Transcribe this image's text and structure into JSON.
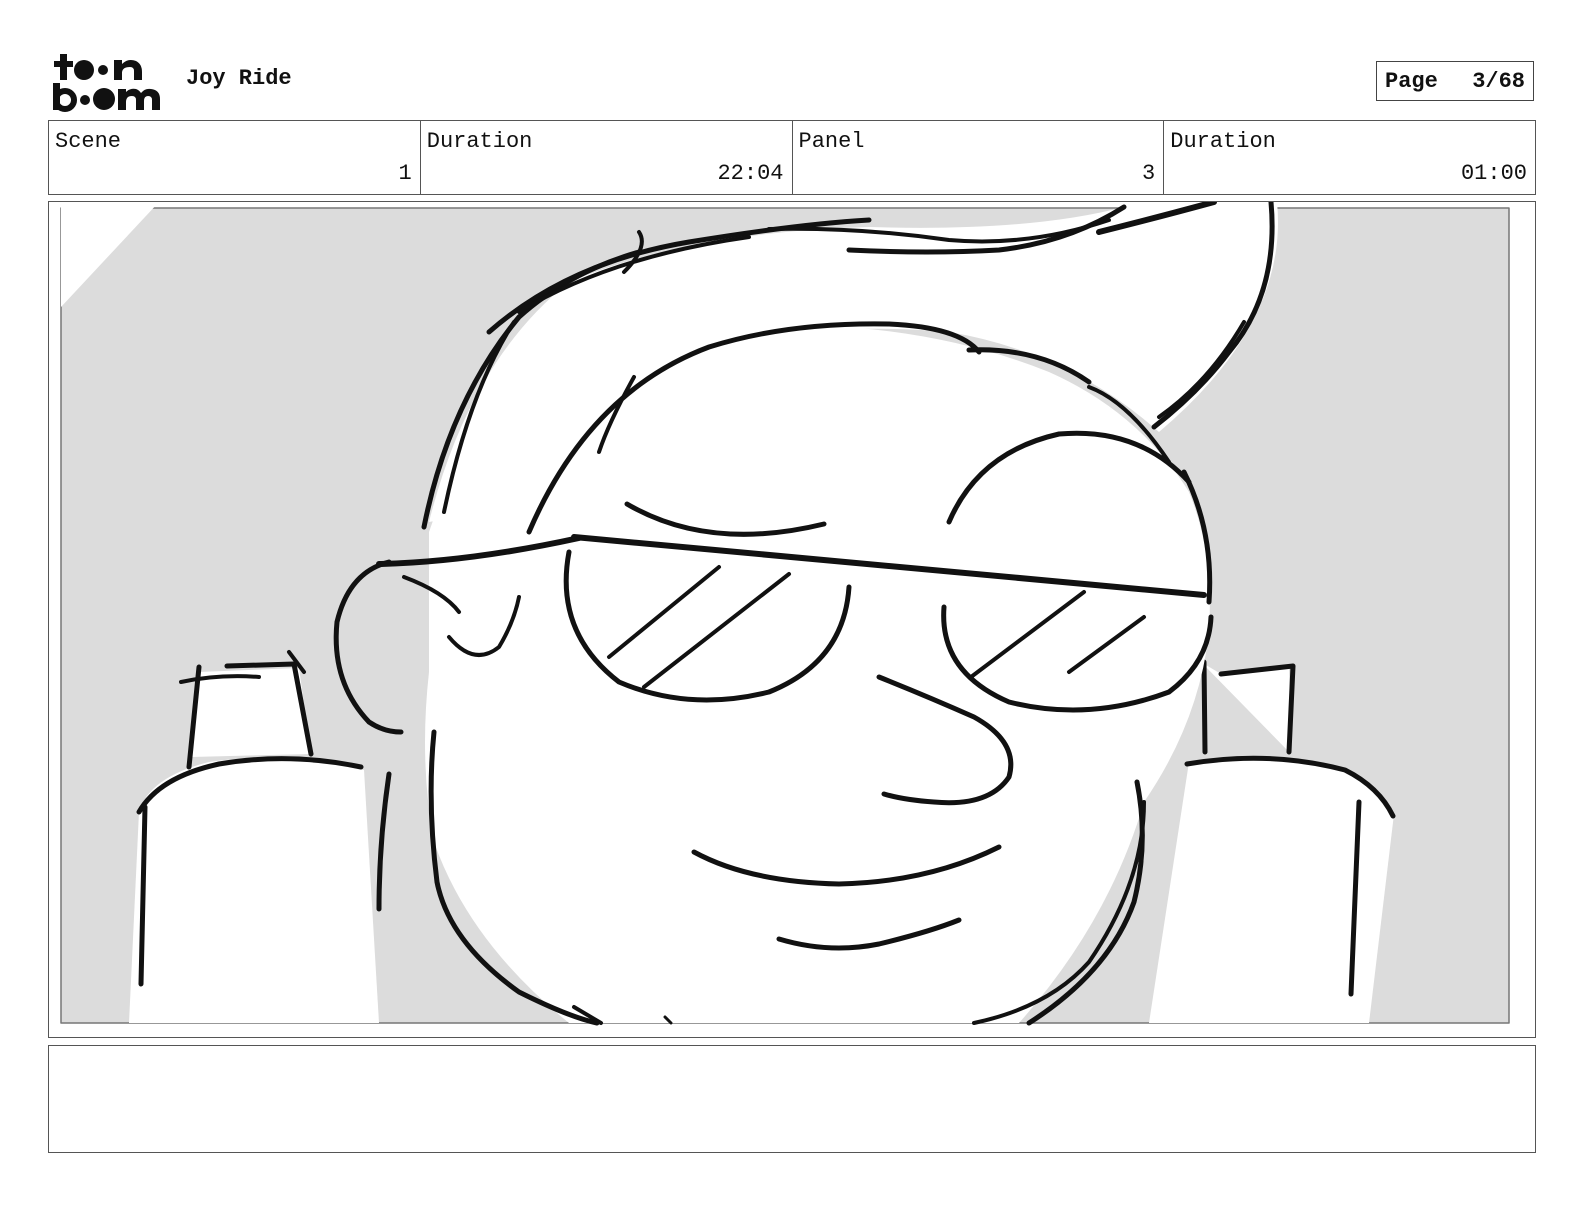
{
  "header": {
    "logo_line1": "toon",
    "logo_line2": "boom",
    "project_title": "Joy Ride",
    "page_label": "Page",
    "page_number": "3/68"
  },
  "info": [
    {
      "label": "Scene",
      "value": "1"
    },
    {
      "label": "Duration",
      "value": "22:04"
    },
    {
      "label": "Panel",
      "value": "3"
    },
    {
      "label": "Duration",
      "value": "01:00"
    }
  ],
  "panel": {
    "background_color": "#dcdcdc",
    "line_color": "#111111",
    "fill_color": "#ffffff"
  },
  "notes": {
    "text": ""
  }
}
